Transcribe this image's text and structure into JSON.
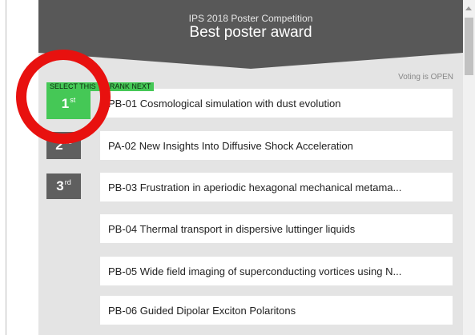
{
  "header": {
    "subtitle": "IPS 2018 Poster Competition",
    "title": "Best poster award"
  },
  "voting_status": "Voting is OPEN",
  "select_hint": "SELECT THIS TO RANK NEXT",
  "ranks": [
    {
      "num": "1",
      "suffix": "st",
      "color": "#45c856"
    },
    {
      "num": "2",
      "suffix": "nd",
      "color": "#5f5f5f"
    },
    {
      "num": "3",
      "suffix": "rd",
      "color": "#5f5f5f"
    }
  ],
  "posters": [
    {
      "label": "PB-01 Cosmological simulation with dust evolution"
    },
    {
      "label": "PA-02 New Insights Into Diffusive Shock Acceleration"
    },
    {
      "label": "PB-03 Frustration in aperiodic hexagonal mechanical metama..."
    },
    {
      "label": "PB-04 Thermal transport in dispersive luttinger liquids"
    },
    {
      "label": "PB-05 Wide field imaging of superconducting vortices using N..."
    },
    {
      "label": "PB-06 Guided Dipolar Exciton Polaritons"
    }
  ],
  "colors": {
    "header_bg": "#585858",
    "panel_bg": "#e4e4e4",
    "accent_green": "#45c856",
    "rank_gray": "#5f5f5f",
    "annotation_red": "#e8110f"
  }
}
